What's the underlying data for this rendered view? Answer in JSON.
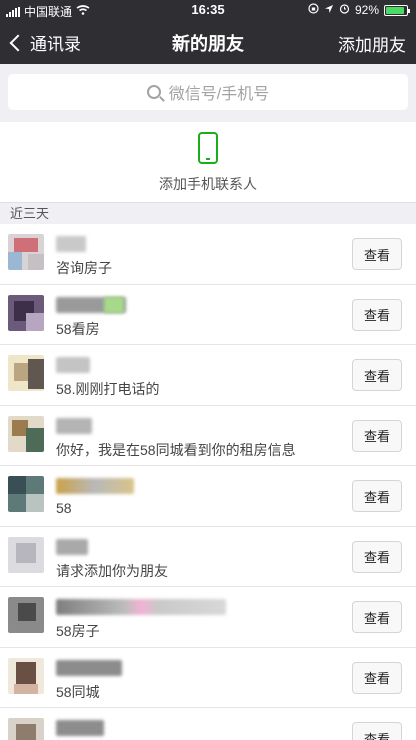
{
  "status_bar": {
    "carrier": "中国联通",
    "time": "16:35",
    "battery": "92%",
    "battery_level": 0.92
  },
  "nav": {
    "back_label": "通讯录",
    "title": "新的朋友",
    "action_label": "添加朋友"
  },
  "search": {
    "placeholder": "微信号/手机号"
  },
  "add_contacts": {
    "label": "添加手机联系人"
  },
  "section": {
    "label": "近三天"
  },
  "requests": [
    {
      "message": "咨询房子",
      "button": "查看"
    },
    {
      "message": "58看房",
      "button": "查看"
    },
    {
      "message": "58.刚刚打电话的",
      "button": "查看"
    },
    {
      "message": "你好，我是在58同城看到你的租房信息",
      "button": "查看"
    },
    {
      "message": "58",
      "button": "查看"
    },
    {
      "message": "请求添加你为朋友",
      "button": "查看"
    },
    {
      "message": "58房子",
      "button": "查看"
    },
    {
      "message": "58同城",
      "button": "查看"
    },
    {
      "message": "",
      "button": "查看"
    }
  ],
  "colors": {
    "nav_background": "#2f2e33",
    "accent_green": "#1aad19",
    "page_background": "#efeff4"
  }
}
